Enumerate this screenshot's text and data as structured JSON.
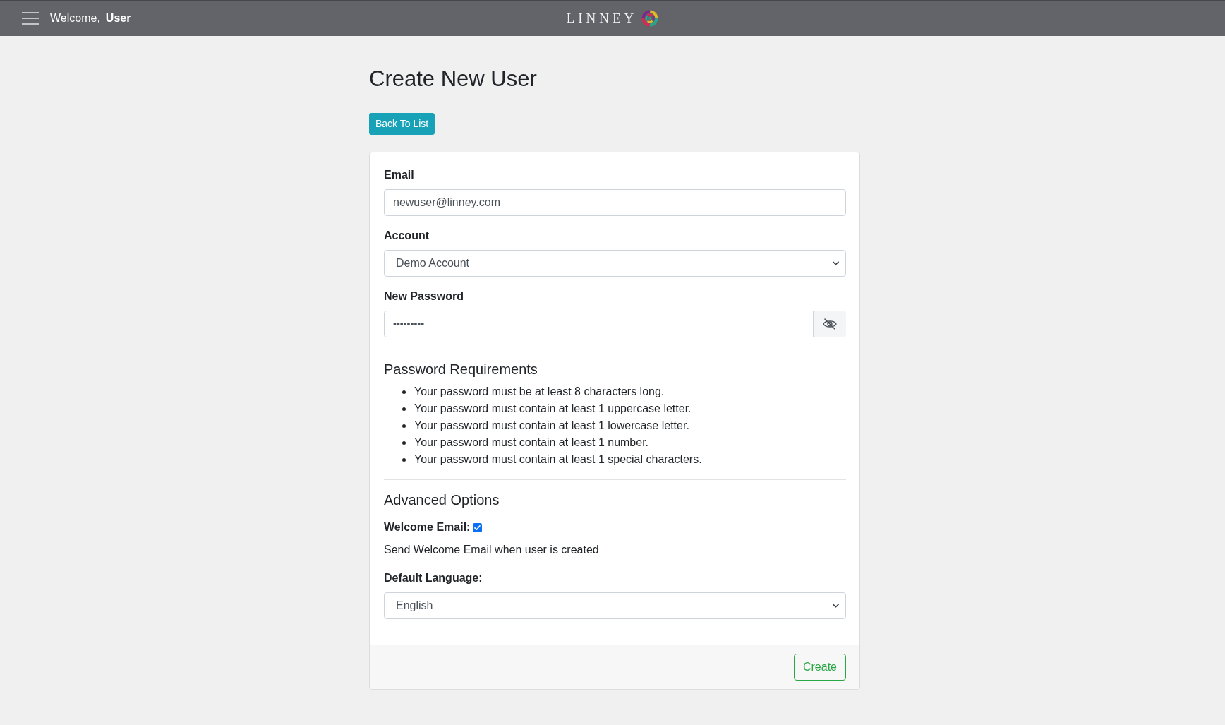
{
  "header": {
    "greeting": "Welcome,",
    "user_name": "User",
    "logo_text": "LINNEY"
  },
  "page": {
    "title": "Create New User",
    "back_button": "Back To List"
  },
  "form": {
    "email": {
      "label": "Email",
      "value": "newuser@linney.com"
    },
    "account": {
      "label": "Account",
      "value": "Demo Account"
    },
    "password": {
      "label": "New Password",
      "value": "•••••••••",
      "revealed": false
    }
  },
  "requirements": {
    "title": "Password Requirements",
    "items": [
      "Your password must be at least 8 characters long.",
      "Your password must contain at least 1 uppercase letter.",
      "Your password must contain at least 1 lowercase letter.",
      "Your password must contain at least 1 number.",
      "Your password must contain at least 1 special characters."
    ]
  },
  "advanced": {
    "title": "Advanced Options",
    "welcome_email": {
      "label": "Welcome Email:",
      "checked": true,
      "description": "Send Welcome Email when user is created"
    },
    "language": {
      "label": "Default Language:",
      "value": "English"
    }
  },
  "footer": {
    "button": "Create"
  }
}
